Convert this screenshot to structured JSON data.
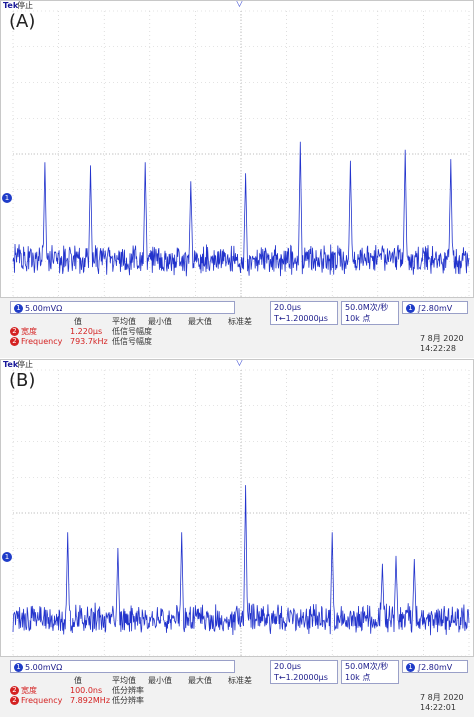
{
  "panels": [
    {
      "id": "a",
      "label": "(A)",
      "top": {
        "brand": "Tek",
        "state": "停止",
        "trigger_position_icon": "trigger-position-icon"
      },
      "channel_marker": "1",
      "spike_positions": [
        0.07,
        0.17,
        0.29,
        0.39,
        0.51,
        0.63,
        0.74,
        0.86,
        0.96
      ],
      "spike_heights": [
        0.62,
        0.6,
        0.62,
        0.5,
        0.55,
        0.75,
        0.63,
        0.7,
        0.64
      ],
      "readout": {
        "ch1_scale": "5.00mVΩ",
        "timebase": "20.0µs",
        "trigger_pos": "1.20000µs",
        "sample_rate": "50.0M次/秒",
        "points": "10k 点",
        "trigger_level": "2.80mV",
        "trigger_channel": "1",
        "meas_headers": [
          "值",
          "平均值",
          "最小值",
          "最大值",
          "标准差"
        ],
        "meas": [
          {
            "ch": "2",
            "name": "宽度",
            "value": "1.220µs",
            "note": "低信号幅度"
          },
          {
            "ch": "2",
            "name": "Frequency",
            "value": "793.7kHz",
            "note": "低信号幅度"
          }
        ],
        "date": "7 8月 2020",
        "time": "14:22:28"
      }
    },
    {
      "id": "b",
      "label": "(B)",
      "top": {
        "brand": "Tek",
        "state": "停止",
        "trigger_position_icon": "trigger-position-icon"
      },
      "channel_marker": "1",
      "spike_positions": [
        0.12,
        0.23,
        0.37,
        0.51,
        0.7,
        0.81,
        0.84,
        0.88
      ],
      "spike_heights": [
        0.55,
        0.45,
        0.55,
        0.85,
        0.55,
        0.35,
        0.4,
        0.38
      ],
      "readout": {
        "ch1_scale": "5.00mVΩ",
        "timebase": "20.0µs",
        "trigger_pos": "1.20000µs",
        "sample_rate": "50.0M次/秒",
        "points": "10k 点",
        "trigger_level": "2.80mV",
        "trigger_channel": "1",
        "meas_headers": [
          "值",
          "平均值",
          "最小值",
          "最大值",
          "标准差"
        ],
        "meas": [
          {
            "ch": "2",
            "name": "宽度",
            "value": "100.0ns",
            "note": "低分辨率"
          },
          {
            "ch": "2",
            "name": "Frequency",
            "value": "7.892MHz",
            "note": "低分辨率"
          }
        ],
        "date": "7 8月 2020",
        "time": "14:22:01"
      }
    }
  ],
  "colors": {
    "trace": "#2233cc",
    "grid": "#c8c8c8",
    "accent_red": "#d42222",
    "channel_blue": "#1f3cc8"
  }
}
